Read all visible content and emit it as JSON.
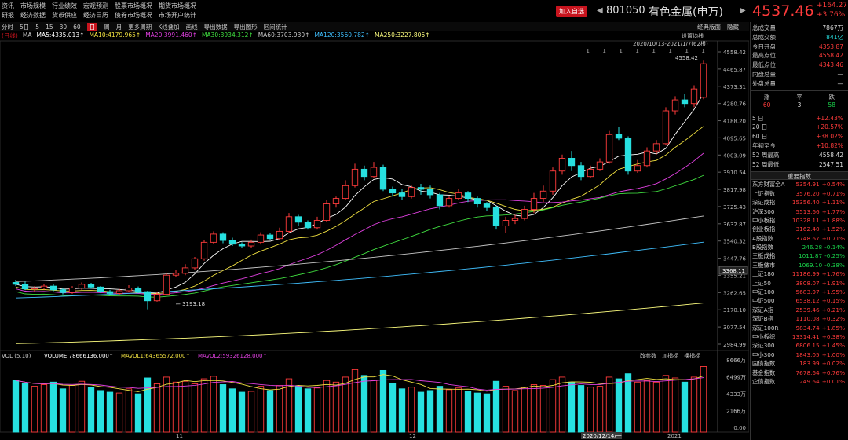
{
  "menus": {
    "row1": [
      "资讯",
      "市场规模",
      "行业绩效",
      "宏观预测",
      "股票市场概况",
      "期货市场概况"
    ],
    "row2": [
      "研报",
      "经济数据",
      "货币供应",
      "经济日历",
      "债券市场概况",
      "市场开户统计"
    ]
  },
  "header": {
    "add_label": "加入自选",
    "prev_arrow": "◀",
    "next_arrow": "▶",
    "code": "801050",
    "name": "有色金属(申万)",
    "price": "4537.46",
    "change": "+164.27",
    "change_pct": "+3.76%"
  },
  "toolbar": {
    "items": [
      "分时",
      "5日",
      "5",
      "15",
      "30",
      "60",
      "日",
      "周",
      "月",
      "更多周期",
      "K线叠加",
      "画线",
      "导出数据",
      "导出图形",
      "区间统计"
    ],
    "active": "日",
    "right_items": [
      "经典版面",
      "隐藏"
    ]
  },
  "ma_legend": {
    "prefix": "(日线)",
    "items": [
      {
        "label": "MA",
        "color": "#c8c8c8"
      },
      {
        "label": "MA5:4335.013↑",
        "color": "#ffffff"
      },
      {
        "label": "MA10:4179.965↑",
        "color": "#f0e040"
      },
      {
        "label": "MA20:3991.460↑",
        "color": "#e040e0"
      },
      {
        "label": "MA30:3934.312↑",
        "color": "#40e040"
      },
      {
        "label": "MA60:3703.930↑",
        "color": "#c8c8c8"
      },
      {
        "label": "MA120:3560.782↑",
        "color": "#40c0ff"
      },
      {
        "label": "MA250:3227.806↑",
        "color": "#ffff80"
      }
    ]
  },
  "chart_overlay": {
    "settings_label": "设置均线",
    "range_label": "2020/10/13-2021/1/7(62根)",
    "high_annotation": "4558.42",
    "low_annotation": "3193.18",
    "crosshair_value": "3368.11",
    "price_ticks": [
      "4558.42",
      "4465.87",
      "4373.31",
      "4280.76",
      "4188.20",
      "4095.65",
      "4003.09",
      "3910.54",
      "3817.98",
      "3725.43",
      "3632.87",
      "3540.32",
      "3447.76",
      "3355.21",
      "3262.65",
      "3170.10",
      "3077.54",
      "2984.99"
    ],
    "date_labels": [
      "11",
      "12",
      "2021"
    ],
    "date_highlight": "2020/12/14/一"
  },
  "volume": {
    "legend": [
      {
        "label": "VOL (5,10)",
        "color": "#c8c8c8"
      },
      {
        "label": "VOLUME:78666136.000↑",
        "color": "#ffffff"
      },
      {
        "label": "MAVOL1:64365572.000↑",
        "color": "#f0e040"
      },
      {
        "label": "MAVOL2:59326128.000↑",
        "color": "#e040e0"
      }
    ],
    "buttons": [
      "改参数",
      "加指标",
      "换指标"
    ],
    "ticks": [
      "8666万",
      "6499万",
      "4333万",
      "2166万",
      "0.00"
    ]
  },
  "quote": {
    "rows": [
      {
        "label": "总成交量",
        "value": "7867万",
        "color": "#dddddd"
      },
      {
        "label": "总成交额",
        "value": "841亿",
        "color": "#27e0e0"
      },
      {
        "label": "今日开盘",
        "value": "4353.87",
        "color": "#ff3b3b"
      },
      {
        "label": "最高点位",
        "value": "4558.42",
        "color": "#ff3b3b"
      },
      {
        "label": "最低点位",
        "value": "4343.46",
        "color": "#ff3b3b"
      },
      {
        "label": "内盘总量",
        "value": "—",
        "color": "#dddddd"
      },
      {
        "label": "外盘总量",
        "value": "—",
        "color": "#dddddd"
      }
    ],
    "breadth": {
      "labels": [
        "涨",
        "平",
        "跌"
      ],
      "values": [
        "60",
        "3",
        "58"
      ]
    },
    "periods": [
      {
        "label": "5 日",
        "value": "+12.43%"
      },
      {
        "label": "20 日",
        "value": "+20.57%"
      },
      {
        "label": "60 日",
        "value": "+38.02%"
      },
      {
        "label": "年初至今",
        "value": "+10.82%"
      },
      {
        "label": "52 周最高",
        "value": "4558.42"
      },
      {
        "label": "52 周最低",
        "value": "2547.51"
      }
    ]
  },
  "indices": {
    "title": "重要指数",
    "items": [
      {
        "name": "东方财富全A",
        "value": "5354.91",
        "pct": "+0.54%",
        "up": true
      },
      {
        "name": "上证指数",
        "value": "3576.20",
        "pct": "+0.71%",
        "up": true
      },
      {
        "name": "深证成指",
        "value": "15356.40",
        "pct": "+1.11%",
        "up": true
      },
      {
        "name": "沪深300",
        "value": "5513.66",
        "pct": "+1.77%",
        "up": true
      },
      {
        "name": "中小板指",
        "value": "10328.11",
        "pct": "+1.88%",
        "up": true
      },
      {
        "name": "创业板指",
        "value": "3162.40",
        "pct": "+1.52%",
        "up": true
      },
      {
        "name": "A股指数",
        "value": "3748.67",
        "pct": "+0.71%",
        "up": true
      },
      {
        "name": "B股指数",
        "value": "246.28",
        "pct": "-0.14%",
        "up": false
      },
      {
        "name": "三板成指",
        "value": "1011.87",
        "pct": "-0.25%",
        "up": false
      },
      {
        "name": "三板做市",
        "value": "1069.10",
        "pct": "-0.38%",
        "up": false
      },
      {
        "name": "上证180",
        "value": "11186.99",
        "pct": "+1.76%",
        "up": true
      },
      {
        "name": "上证50",
        "value": "3808.07",
        "pct": "+1.91%",
        "up": true
      },
      {
        "name": "中证100",
        "value": "5683.97",
        "pct": "+1.95%",
        "up": true
      },
      {
        "name": "中证500",
        "value": "6538.12",
        "pct": "+0.15%",
        "up": true
      },
      {
        "name": "深证A指",
        "value": "2539.46",
        "pct": "+0.21%",
        "up": true
      },
      {
        "name": "深证B指",
        "value": "1110.08",
        "pct": "+0.32%",
        "up": true
      },
      {
        "name": "深证100R",
        "value": "9834.74",
        "pct": "+1.85%",
        "up": true
      },
      {
        "name": "中小板综",
        "value": "13314.41",
        "pct": "+0.38%",
        "up": true
      },
      {
        "name": "深证300",
        "value": "6806.15",
        "pct": "+1.45%",
        "up": true
      },
      {
        "name": "中小300",
        "value": "1843.05",
        "pct": "+1.00%",
        "up": true
      },
      {
        "name": "国债指数",
        "value": "183.99",
        "pct": "+0.02%",
        "up": true
      },
      {
        "name": "基金指数",
        "value": "7678.64",
        "pct": "+0.76%",
        "up": true
      },
      {
        "name": "企债指数",
        "value": "249.64",
        "pct": "+0.01%",
        "up": true
      }
    ]
  },
  "chart_data": {
    "type": "candlestick",
    "price_range": [
      2984.99,
      4620
    ],
    "volume_range": [
      0,
      8666
    ],
    "candles": [
      [
        3340,
        3330,
        3355,
        3320,
        62
      ],
      [
        3330,
        3305,
        3345,
        3298,
        58
      ],
      [
        3305,
        3310,
        3320,
        3290,
        55
      ],
      [
        3310,
        3320,
        3330,
        3300,
        57
      ],
      [
        3320,
        3300,
        3330,
        3292,
        60
      ],
      [
        3300,
        3285,
        3310,
        3275,
        52
      ],
      [
        3285,
        3310,
        3320,
        3278,
        56
      ],
      [
        3310,
        3330,
        3340,
        3300,
        61
      ],
      [
        3330,
        3315,
        3338,
        3305,
        54
      ],
      [
        3315,
        3290,
        3320,
        3282,
        50
      ],
      [
        3290,
        3280,
        3300,
        3270,
        48
      ],
      [
        3280,
        3295,
        3305,
        3270,
        47
      ],
      [
        3295,
        3310,
        3325,
        3290,
        52
      ],
      [
        3310,
        3290,
        3318,
        3283,
        46
      ],
      [
        3290,
        3240,
        3295,
        3193,
        65
      ],
      [
        3240,
        3275,
        3290,
        3235,
        58
      ],
      [
        3275,
        3380,
        3390,
        3270,
        66
      ],
      [
        3380,
        3390,
        3410,
        3370,
        60
      ],
      [
        3390,
        3420,
        3440,
        3380,
        61
      ],
      [
        3420,
        3470,
        3480,
        3410,
        58
      ],
      [
        3470,
        3560,
        3570,
        3460,
        64
      ],
      [
        3560,
        3605,
        3620,
        3550,
        67
      ],
      [
        3605,
        3570,
        3615,
        3555,
        57
      ],
      [
        3570,
        3550,
        3585,
        3540,
        52
      ],
      [
        3550,
        3540,
        3560,
        3530,
        48
      ],
      [
        3540,
        3560,
        3575,
        3530,
        49
      ],
      [
        3560,
        3600,
        3615,
        3548,
        55
      ],
      [
        3600,
        3580,
        3610,
        3570,
        50
      ],
      [
        3580,
        3620,
        3640,
        3570,
        56
      ],
      [
        3620,
        3700,
        3720,
        3610,
        64
      ],
      [
        3700,
        3670,
        3710,
        3650,
        55
      ],
      [
        3670,
        3640,
        3680,
        3630,
        52
      ],
      [
        3640,
        3680,
        3700,
        3630,
        53
      ],
      [
        3680,
        3770,
        3790,
        3670,
        62
      ],
      [
        3770,
        3800,
        3810,
        3750,
        60
      ],
      [
        3800,
        3870,
        3900,
        3790,
        66
      ],
      [
        3870,
        3960,
        3990,
        3860,
        75
      ],
      [
        3960,
        3920,
        3980,
        3900,
        68
      ],
      [
        3920,
        3970,
        4000,
        3910,
        62
      ],
      [
        3970,
        3850,
        3985,
        3840,
        74
      ],
      [
        3850,
        3830,
        3865,
        3810,
        58
      ],
      [
        3830,
        3810,
        3850,
        3790,
        52
      ],
      [
        3810,
        3860,
        3870,
        3800,
        54
      ],
      [
        3860,
        3850,
        3880,
        3820,
        48
      ],
      [
        3850,
        3820,
        3870,
        3800,
        50
      ],
      [
        3820,
        3760,
        3830,
        3740,
        55
      ],
      [
        3760,
        3800,
        3810,
        3750,
        51
      ],
      [
        3800,
        3830,
        3850,
        3790,
        53
      ],
      [
        3830,
        3800,
        3840,
        3780,
        49
      ],
      [
        3800,
        3770,
        3810,
        3750,
        47
      ],
      [
        3770,
        3750,
        3780,
        3730,
        46
      ],
      [
        3750,
        3650,
        3760,
        3630,
        61
      ],
      [
        3650,
        3680,
        3700,
        3610,
        55
      ],
      [
        3680,
        3690,
        3710,
        3660,
        50
      ],
      [
        3690,
        3740,
        3760,
        3680,
        54
      ],
      [
        3740,
        3800,
        3830,
        3720,
        57
      ],
      [
        3800,
        3840,
        3870,
        3780,
        56
      ],
      [
        3840,
        3950,
        3970,
        3820,
        63
      ],
      [
        3950,
        4020,
        4040,
        3930,
        66
      ],
      [
        4020,
        3980,
        4060,
        3950,
        60
      ],
      [
        3980,
        3920,
        4000,
        3900,
        56
      ],
      [
        3920,
        3960,
        3980,
        3910,
        54
      ],
      [
        3960,
        4000,
        4020,
        3950,
        55
      ],
      [
        4000,
        4150,
        4170,
        3990,
        66
      ],
      [
        4150,
        4130,
        4190,
        4120,
        64
      ],
      [
        4130,
        3950,
        4140,
        3930,
        70
      ],
      [
        3950,
        3980,
        4010,
        3940,
        60
      ],
      [
        3980,
        4060,
        4080,
        3970,
        62
      ],
      [
        4060,
        4100,
        4120,
        4040,
        60
      ],
      [
        4100,
        4280,
        4300,
        4090,
        68
      ],
      [
        4280,
        4340,
        4360,
        4260,
        65
      ],
      [
        4340,
        4320,
        4375,
        4300,
        60
      ],
      [
        4320,
        4400,
        4420,
        4300,
        66
      ],
      [
        4353.87,
        4537.46,
        4558.42,
        4343.46,
        78.67
      ]
    ],
    "volume_scale": 0.01
  }
}
